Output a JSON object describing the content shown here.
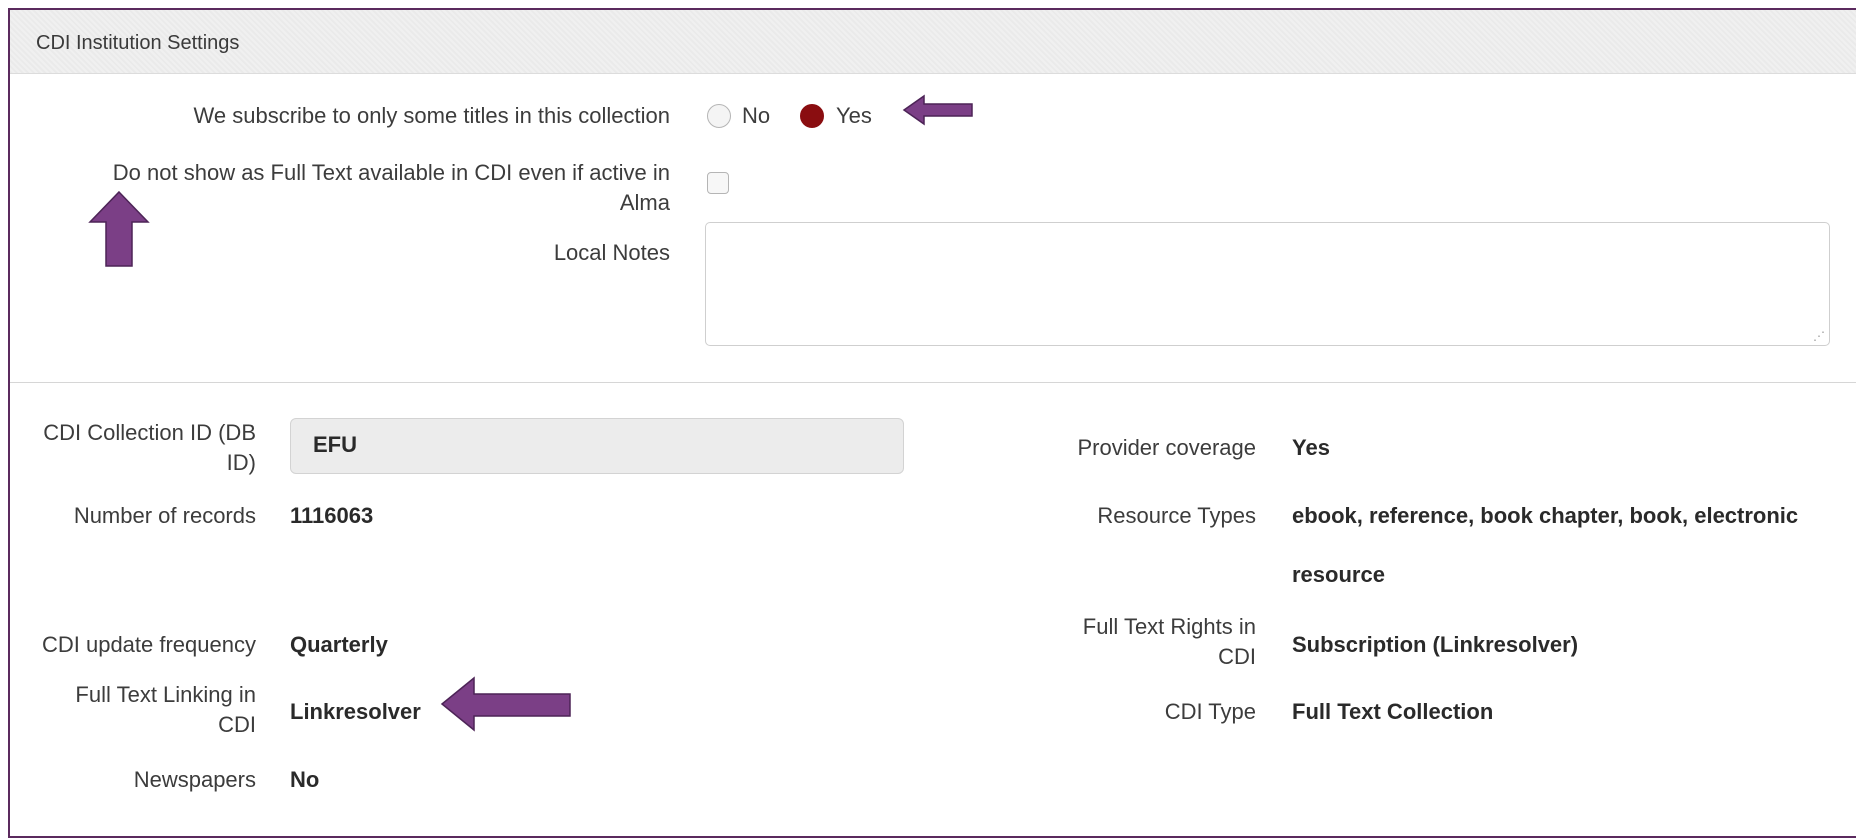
{
  "panel": {
    "title": "CDI Institution Settings"
  },
  "settings": {
    "subscribe_label": "We subscribe to only some titles in this collection",
    "radio_no_label": "No",
    "radio_yes_label": "Yes",
    "radio_selected": "Yes",
    "fulltext_label_line1": "Do not show as Full Text available in CDI even if active in",
    "fulltext_label_line2": "Alma",
    "fulltext_checked": false,
    "local_notes_label": "Local Notes",
    "local_notes_value": ""
  },
  "details": {
    "collection_id_label_line1": "CDI Collection ID (DB",
    "collection_id_label_line2": "ID)",
    "collection_id_value": "EFU",
    "num_records_label": "Number of records",
    "num_records_value": "1116063",
    "update_freq_label": "CDI update frequency",
    "update_freq_value": "Quarterly",
    "linking_label_line1": "Full Text Linking in",
    "linking_label_line2": "CDI",
    "linking_value": "Linkresolver",
    "newspapers_label": "Newspapers",
    "newspapers_value": "No",
    "provider_coverage_label": "Provider coverage",
    "provider_coverage_value": "Yes",
    "resource_types_label": "Resource Types",
    "resource_types_value_line1": "ebook, reference, book chapter, book, electronic",
    "resource_types_value_line2": "resource",
    "rights_label_line1": "Full Text Rights in",
    "rights_label_line2": "CDI",
    "rights_value": "Subscription (Linkresolver)",
    "cdi_type_label": "CDI Type",
    "cdi_type_value": "Full Text Collection"
  },
  "annotations": {
    "arrow_color": "#7b3f86"
  }
}
